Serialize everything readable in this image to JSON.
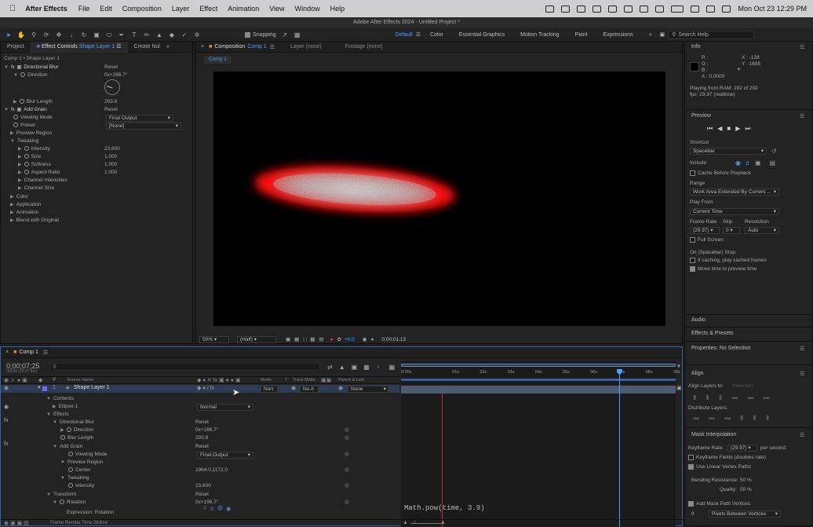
{
  "menubar": {
    "app_name": "After Effects",
    "menus": [
      "File",
      "Edit",
      "Composition",
      "Layer",
      "Effect",
      "Animation",
      "View",
      "Window",
      "Help"
    ],
    "clock": "Mon Oct 23  12:29 PM"
  },
  "window_title": "Adobe After Effects 2024 - Untitled Project *",
  "toolbar": {
    "snapping": "Snapping",
    "workspaces": [
      "Default",
      "Color",
      "Essential Graphics",
      "Motion Tracking",
      "Paint",
      "Expressions"
    ],
    "search_placeholder": "Search Help"
  },
  "left_panel": {
    "tabs": [
      "Project",
      "Effect Controls",
      "Shape Layer 1",
      "Create Nul"
    ],
    "subtitle": "Comp 1 • Shape Layer 1",
    "effects": [
      {
        "label": "Directional Blur",
        "value": "Reset"
      },
      {
        "label": "Direction",
        "value": "0x+286.7°"
      },
      {
        "label": "Blur Length",
        "value": "293.8"
      },
      {
        "label": "Add Grain",
        "value": "Reset"
      },
      {
        "label": "Viewing Mode",
        "value": "Final Output"
      },
      {
        "label": "Preset",
        "value": "[None]"
      },
      {
        "label": "Preview Region",
        "value": ""
      },
      {
        "label": "Tweaking",
        "value": ""
      },
      {
        "label": "Intensity",
        "value": "23.600"
      },
      {
        "label": "Size",
        "value": "1.000"
      },
      {
        "label": "Softness",
        "value": "1.000"
      },
      {
        "label": "Aspect Ratio",
        "value": "1.000"
      },
      {
        "label": "Channel Intensities",
        "value": ""
      },
      {
        "label": "Channel Size",
        "value": ""
      },
      {
        "label": "Color",
        "value": ""
      },
      {
        "label": "Application",
        "value": ""
      },
      {
        "label": "Animation",
        "value": ""
      },
      {
        "label": "Blend with Original",
        "value": ""
      }
    ]
  },
  "comp_panel": {
    "tabs": [
      "Composition",
      "Comp 1",
      "Layer (none)",
      "Footage (none)"
    ],
    "breadcrumb": "Comp 1",
    "zoom": "50%",
    "resolution": "(Half)",
    "exposure": "+0.0",
    "timecode": "0;00;01;13"
  },
  "right_panel": {
    "info_title": "Info",
    "info_rgb": [
      "R :",
      "G :",
      "B :",
      "A : 0.0000"
    ],
    "info_xy": [
      "X : -128",
      "Y : 1688"
    ],
    "info_status": [
      "Playing from RAM: 292 of 292",
      "fps: 29.97 (realtime)"
    ],
    "preview_title": "Preview",
    "shortcut_label": "Shortcut",
    "shortcut_value": "Spacebar",
    "include_label": "Include:",
    "cache_before": "Cache Before Playback",
    "range_label": "Range",
    "range_value": "Work Area Extended By Current ...",
    "play_from_label": "Play From",
    "play_from_value": "Current Time",
    "frame_rate_label": "Frame Rate",
    "skip_label": "Skip",
    "resolution_label": "Resolution",
    "frame_rate_value": "(29.97)",
    "skip_value": "0",
    "resolution_value": "Auto",
    "full_screen": "Full Screen",
    "stop_label": "On (Spacebar) Stop:",
    "if_caching": "If caching, play cached frames",
    "move_time": "Move time to preview time",
    "audio": "Audio",
    "effects_presets": "Effects & Presets",
    "properties": "Properties: No Selection",
    "align_title": "Align",
    "align_layers_to": "Align Layers to:",
    "align_selection": "Selection",
    "distribute": "Distribute Layers:",
    "mask_title": "Mask Interpolation",
    "keyframe_rate_label": "Keyframe Rate:",
    "keyframe_rate_value": "(29.97)",
    "per_second": "per second",
    "keyframe_fields": "Keyframe Fields (doubles rate)",
    "linear_vertex": "Use Linear Vertex Paths",
    "bending_label": "Bending Resistance:",
    "bending_value": "50 %",
    "quality_label": "Quality:",
    "quality_value": "50 %",
    "add_mask": "Add Mask Path Vertices",
    "vertices_num": "9",
    "vertices_mode": "Pixels Between Vertices"
  },
  "timeline": {
    "tab": "Comp 1",
    "timecode": "0;00;07;25",
    "timecode_sub": "00235 (29.97 fps)",
    "col_source": "Source Name",
    "col_mode": "Mode",
    "col_t": "T",
    "col_trackmatte": "Track Matte",
    "col_parent": "Parent & Link",
    "layer_num": "1",
    "layer_name": "Shape Layer 1",
    "layer_mode": "Norr",
    "layer_matte": "No A",
    "layer_parent": "None",
    "ruler": [
      "0:00s",
      "01s",
      "02s",
      "03s",
      "04s",
      "05s",
      "06s",
      "07s",
      "08s",
      "09s"
    ],
    "props": [
      {
        "label": "Contents",
        "value": ""
      },
      {
        "label": "Ellipse 1",
        "value": "Normal"
      },
      {
        "label": "Effects",
        "value": ""
      },
      {
        "label": "Directional Blur",
        "value": "Reset"
      },
      {
        "label": "Direction",
        "value": "0x+286.7°"
      },
      {
        "label": "Blur Length",
        "value": "293.8"
      },
      {
        "label": "Add Grain",
        "value": "Reset"
      },
      {
        "label": "Viewing Mode",
        "value": "Final Output"
      },
      {
        "label": "Preview Region",
        "value": ""
      },
      {
        "label": "Center",
        "value": "1964.0,1172.0"
      },
      {
        "label": "Tweaking",
        "value": ""
      },
      {
        "label": "Intensity",
        "value": "23.600"
      },
      {
        "label": "Transform",
        "value": "Reset"
      },
      {
        "label": "Rotation",
        "value": "0x+196.7°"
      },
      {
        "label": "Expression: Rotation",
        "value": ""
      }
    ],
    "expression": "Math.pow(time, 3.9)",
    "footer": "Frame Render Time  263ms"
  }
}
